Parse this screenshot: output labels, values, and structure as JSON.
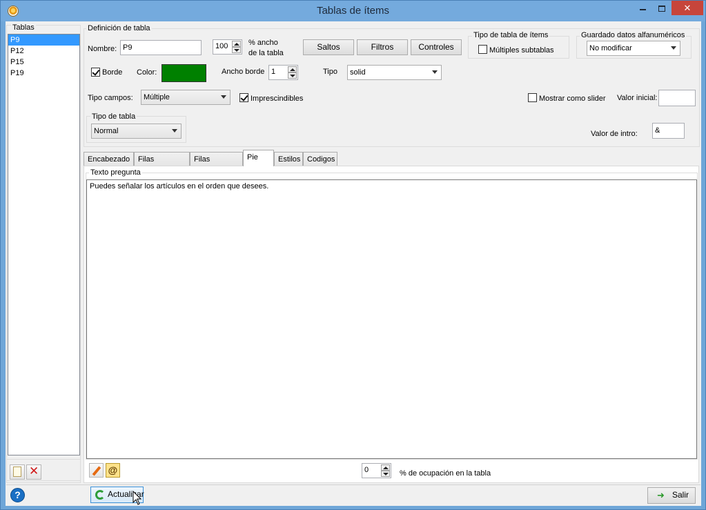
{
  "window": {
    "title": "Tablas de ítems"
  },
  "tablas": {
    "label": "Tablas",
    "items": [
      "P9",
      "P12",
      "P15",
      "P19"
    ]
  },
  "definicion": {
    "label": "Definición de tabla",
    "nombre_label": "Nombre:",
    "nombre_value": "P9",
    "ancho_value": "100",
    "ancho_label_1": "% ancho",
    "ancho_label_2": "de la tabla",
    "saltos": "Saltos",
    "filtros": "Filtros",
    "controles": "Controles",
    "borde_label": "Borde",
    "color_label": "Color:",
    "color_value": "#008000",
    "ancho_borde_label": "Ancho borde",
    "ancho_borde_value": "1",
    "tipo_label": "Tipo",
    "tipo_value": "solid",
    "tipo_campos_label": "Tipo campos:",
    "tipo_campos_value": "Múltiple",
    "imprescindibles_label": "Imprescindibles",
    "tipo_tabla_label": "Tipo de tabla",
    "tipo_tabla_value": "Normal",
    "mostrar_slider_label": "Mostrar como slider",
    "valor_inicial_label": "Valor inicial:",
    "valor_inicial_value": "",
    "valor_intro_label": "Valor  de intro:",
    "valor_intro_value": "&"
  },
  "tipo_items": {
    "label": "Tipo de tabla de ítems",
    "multiples_label": "Múltiples subtablas"
  },
  "guardado": {
    "label": "Guardado datos alfanuméricos",
    "value": "No modificar"
  },
  "tabs": [
    "Encabezado",
    "Filas pregunta",
    "Filas derecha",
    "Pie",
    "Estilos",
    "Codigos"
  ],
  "panel": {
    "texto_pregunta_label": "Texto pregunta",
    "texto": "Puedes señalar los artículos en el orden que desees.",
    "ocupacion_value": "0",
    "ocupacion_label": "% de ocupación en la tabla"
  },
  "footer": {
    "actualizar": "Actualizar",
    "salir": "Salir"
  }
}
